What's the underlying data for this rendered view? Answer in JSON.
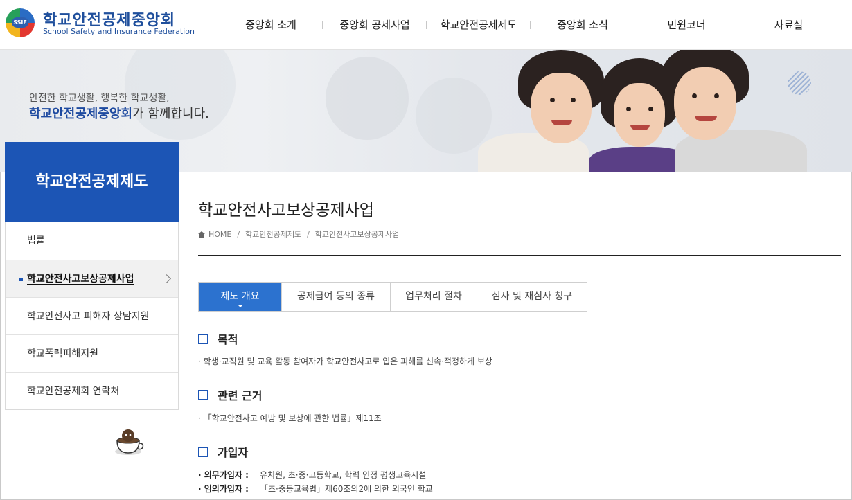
{
  "logo": {
    "title_ko": "학교안전공제중앙회",
    "title_en": "School Safety and Insurance Federation",
    "mark_text": "SSIF"
  },
  "gnb": [
    {
      "label": "중앙회 소개"
    },
    {
      "label": "중앙회 공제사업"
    },
    {
      "label": "학교안전공제제도"
    },
    {
      "label": "중앙회 소식"
    },
    {
      "label": "민원코너"
    },
    {
      "label": "자료실"
    }
  ],
  "hero": {
    "line1": "안전한 학교생활, 행복한 학교생활,",
    "line2_strong": "학교안전공제중앙회",
    "line2_rest": "가 함께합니다."
  },
  "lnb": {
    "title": "학교안전공제제도",
    "items": [
      {
        "label": "법률"
      },
      {
        "label": "학교안전사고보상공제사업"
      },
      {
        "label": "학교안전사고 피해자 상담지원"
      },
      {
        "label": "학교폭력피해지원"
      },
      {
        "label": "학교안전공제회 연락처"
      }
    ]
  },
  "page": {
    "title": "학교안전사고보상공제사업",
    "breadcrumb": [
      "HOME",
      "학교안전공제제도",
      "학교안전사고보상공제사업"
    ]
  },
  "tabs": [
    {
      "label": "제도 개요"
    },
    {
      "label": "공제급여 등의 종류"
    },
    {
      "label": "업무처리 절차"
    },
    {
      "label": "심사 및 재심사 청구"
    }
  ],
  "sections": {
    "purpose": {
      "heading": "목적",
      "text": "· 학생·교직원 및 교육 활동 참여자가 학교안전사고로 입은 피해를 신속·적정하게 보상"
    },
    "basis": {
      "heading": "관련 근거",
      "text": "· 「학교안전사고 예방 및 보상에 관한 법률」제11조"
    },
    "members": {
      "heading": "가입자",
      "rows": [
        {
          "label": "· 의무가입자 :",
          "value": "유치원, 초·중·고등학교, 학력 인정 평생교육시설"
        },
        {
          "label": "· 임의가입자 :",
          "value": "「초·중등교육법」제60조의2에 의한 외국인 학교"
        }
      ]
    }
  },
  "colors": {
    "brand_blue": "#1c55b5",
    "tab_active": "#2c72cf"
  }
}
